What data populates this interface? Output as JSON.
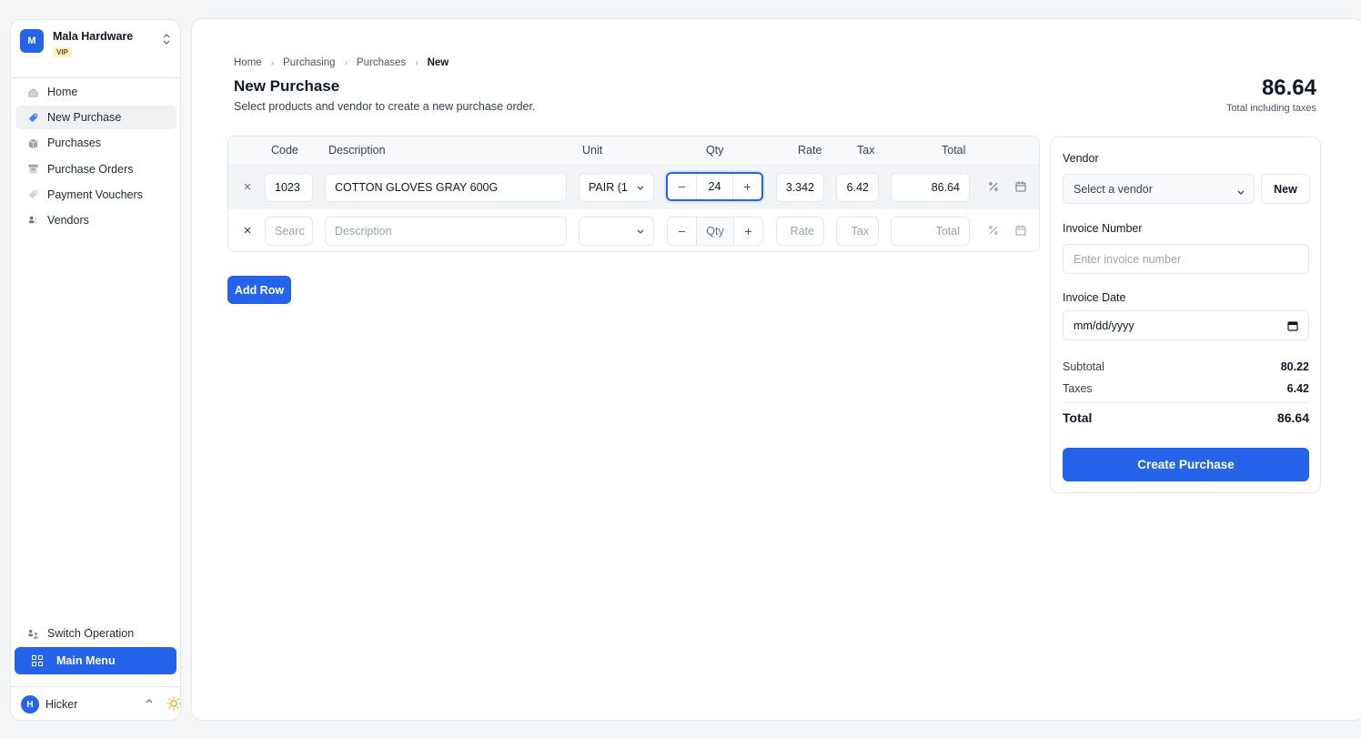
{
  "org": {
    "name": "Mala Hardware",
    "initial": "M",
    "badge": "VIP"
  },
  "nav": {
    "items": [
      {
        "label": "Home",
        "icon": "home-icon"
      },
      {
        "label": "New Purchase",
        "icon": "tag-icon",
        "active": true
      },
      {
        "label": "Purchases",
        "icon": "box-icon"
      },
      {
        "label": "Purchase Orders",
        "icon": "archive-icon"
      },
      {
        "label": "Payment Vouchers",
        "icon": "ticket-icon"
      },
      {
        "label": "Vendors",
        "icon": "users-icon"
      }
    ],
    "switch_operation": "Switch Operation",
    "main_menu": "Main Menu"
  },
  "user": {
    "name": "Hicker",
    "initial": "H"
  },
  "breadcrumb": [
    "Home",
    "Purchasing",
    "Purchases",
    "New"
  ],
  "page": {
    "title": "New Purchase",
    "subtitle": "Select products and vendor to create a new purchase order.",
    "total": "86.64",
    "total_label": "Total including taxes"
  },
  "table": {
    "headers": {
      "code": "Code",
      "description": "Description",
      "unit": "Unit",
      "qty": "Qty",
      "rate": "Rate",
      "tax": "Tax",
      "total": "Total"
    },
    "rows": [
      {
        "code": "1023",
        "description": "COTTON GLOVES GRAY 600G",
        "unit": "PAIR (1",
        "qty": "24",
        "rate": "3.342",
        "tax": "6.42",
        "total": "86.64"
      }
    ],
    "empty_row": {
      "code_ph": "Searc",
      "description_ph": "Description",
      "qty_ph": "Qty",
      "rate_ph": "Rate",
      "tax_ph": "Tax",
      "total_ph": "Total"
    }
  },
  "add_row_label": "Add Row",
  "panel": {
    "vendor_label": "Vendor",
    "vendor_placeholder": "Select a vendor",
    "new_label": "New",
    "invoice_number_label": "Invoice Number",
    "invoice_number_placeholder": "Enter invoice number",
    "invoice_date_label": "Invoice Date",
    "invoice_date_placeholder": "mm/dd/yyyy",
    "subtotal_label": "Subtotal",
    "subtotal": "80.22",
    "taxes_label": "Taxes",
    "taxes": "6.42",
    "total_label": "Total",
    "total": "86.64",
    "create_label": "Create Purchase"
  },
  "colors": {
    "accent": "#2563eb"
  }
}
